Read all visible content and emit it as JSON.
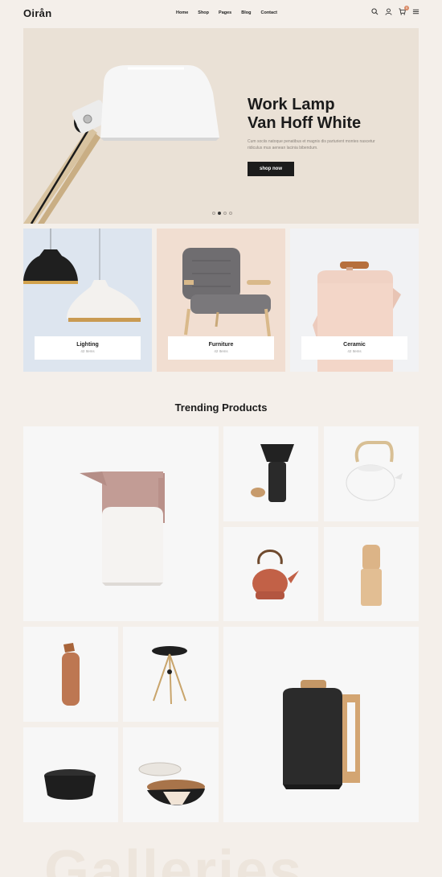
{
  "header": {
    "logo": "Oirån",
    "nav": [
      "Home",
      "Shop",
      "Pages",
      "Blog",
      "Contact"
    ],
    "cart_count": "0",
    "icons": [
      "search-icon",
      "user-icon",
      "cart-icon",
      "menu-icon"
    ]
  },
  "hero": {
    "title_line1": "Work Lamp",
    "title_line2": "Van Hoff White",
    "subtitle": "Cum sociis natoque penatibus et magnis dis parturient montes nascetur ridiculus mus aenean lacinia bibendum.",
    "button": "shop now",
    "slides": 4,
    "active_slide": 2
  },
  "categories": [
    {
      "name": "Lighting",
      "count": "42 Items",
      "bg": "#dde5ef"
    },
    {
      "name": "Furniture",
      "count": "42 Items",
      "bg": "#f1ded1"
    },
    {
      "name": "Ceramic",
      "count": "42 Items",
      "bg": "#f1f2f4"
    }
  ],
  "trending": {
    "title": "Trending Products"
  },
  "galleries_text": "Galleries",
  "colors": {
    "background": "#f4efea",
    "accent": "#d98a66",
    "button": "#1c1c1c"
  }
}
